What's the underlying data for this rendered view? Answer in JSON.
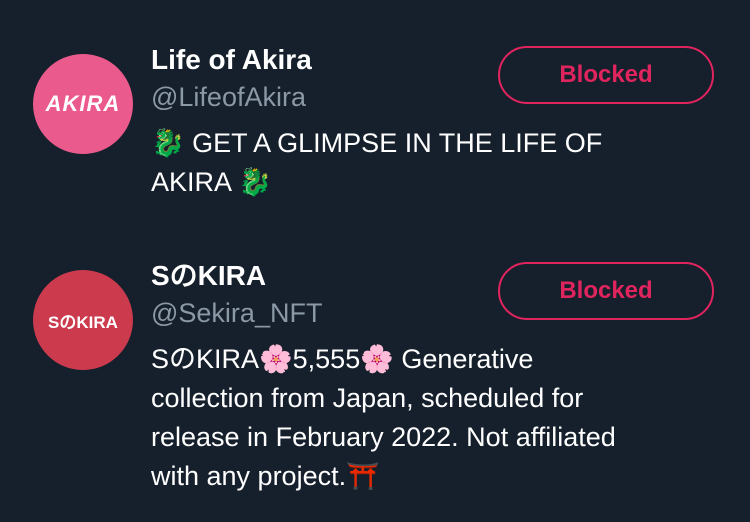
{
  "users": [
    {
      "avatar_text": "AKIRA",
      "avatar_color": "#eb5a8c",
      "name": "Life of Akira",
      "handle": "@LifeofAkira",
      "bio_line1": "🐉 GET A GLIMPSE IN THE LIFE OF",
      "bio_line2": "AKIRA 🐉",
      "button_label": "Blocked"
    },
    {
      "avatar_text": "SのKIRA",
      "avatar_color": "#cc3a4d",
      "name": "SのKIRA",
      "handle": "@Sekira_NFT",
      "bio_line1": "SのKIRA🌸5,555🌸 Generative",
      "bio_line2": "collection from Japan, scheduled for",
      "bio_line3": "release in February 2022. Not affiliated",
      "bio_line4": "with any project.⛩️",
      "button_label": "Blocked"
    }
  ],
  "colors": {
    "background": "#16202c",
    "blocked_accent": "#e0245e",
    "handle_gray": "#8b98a5"
  }
}
